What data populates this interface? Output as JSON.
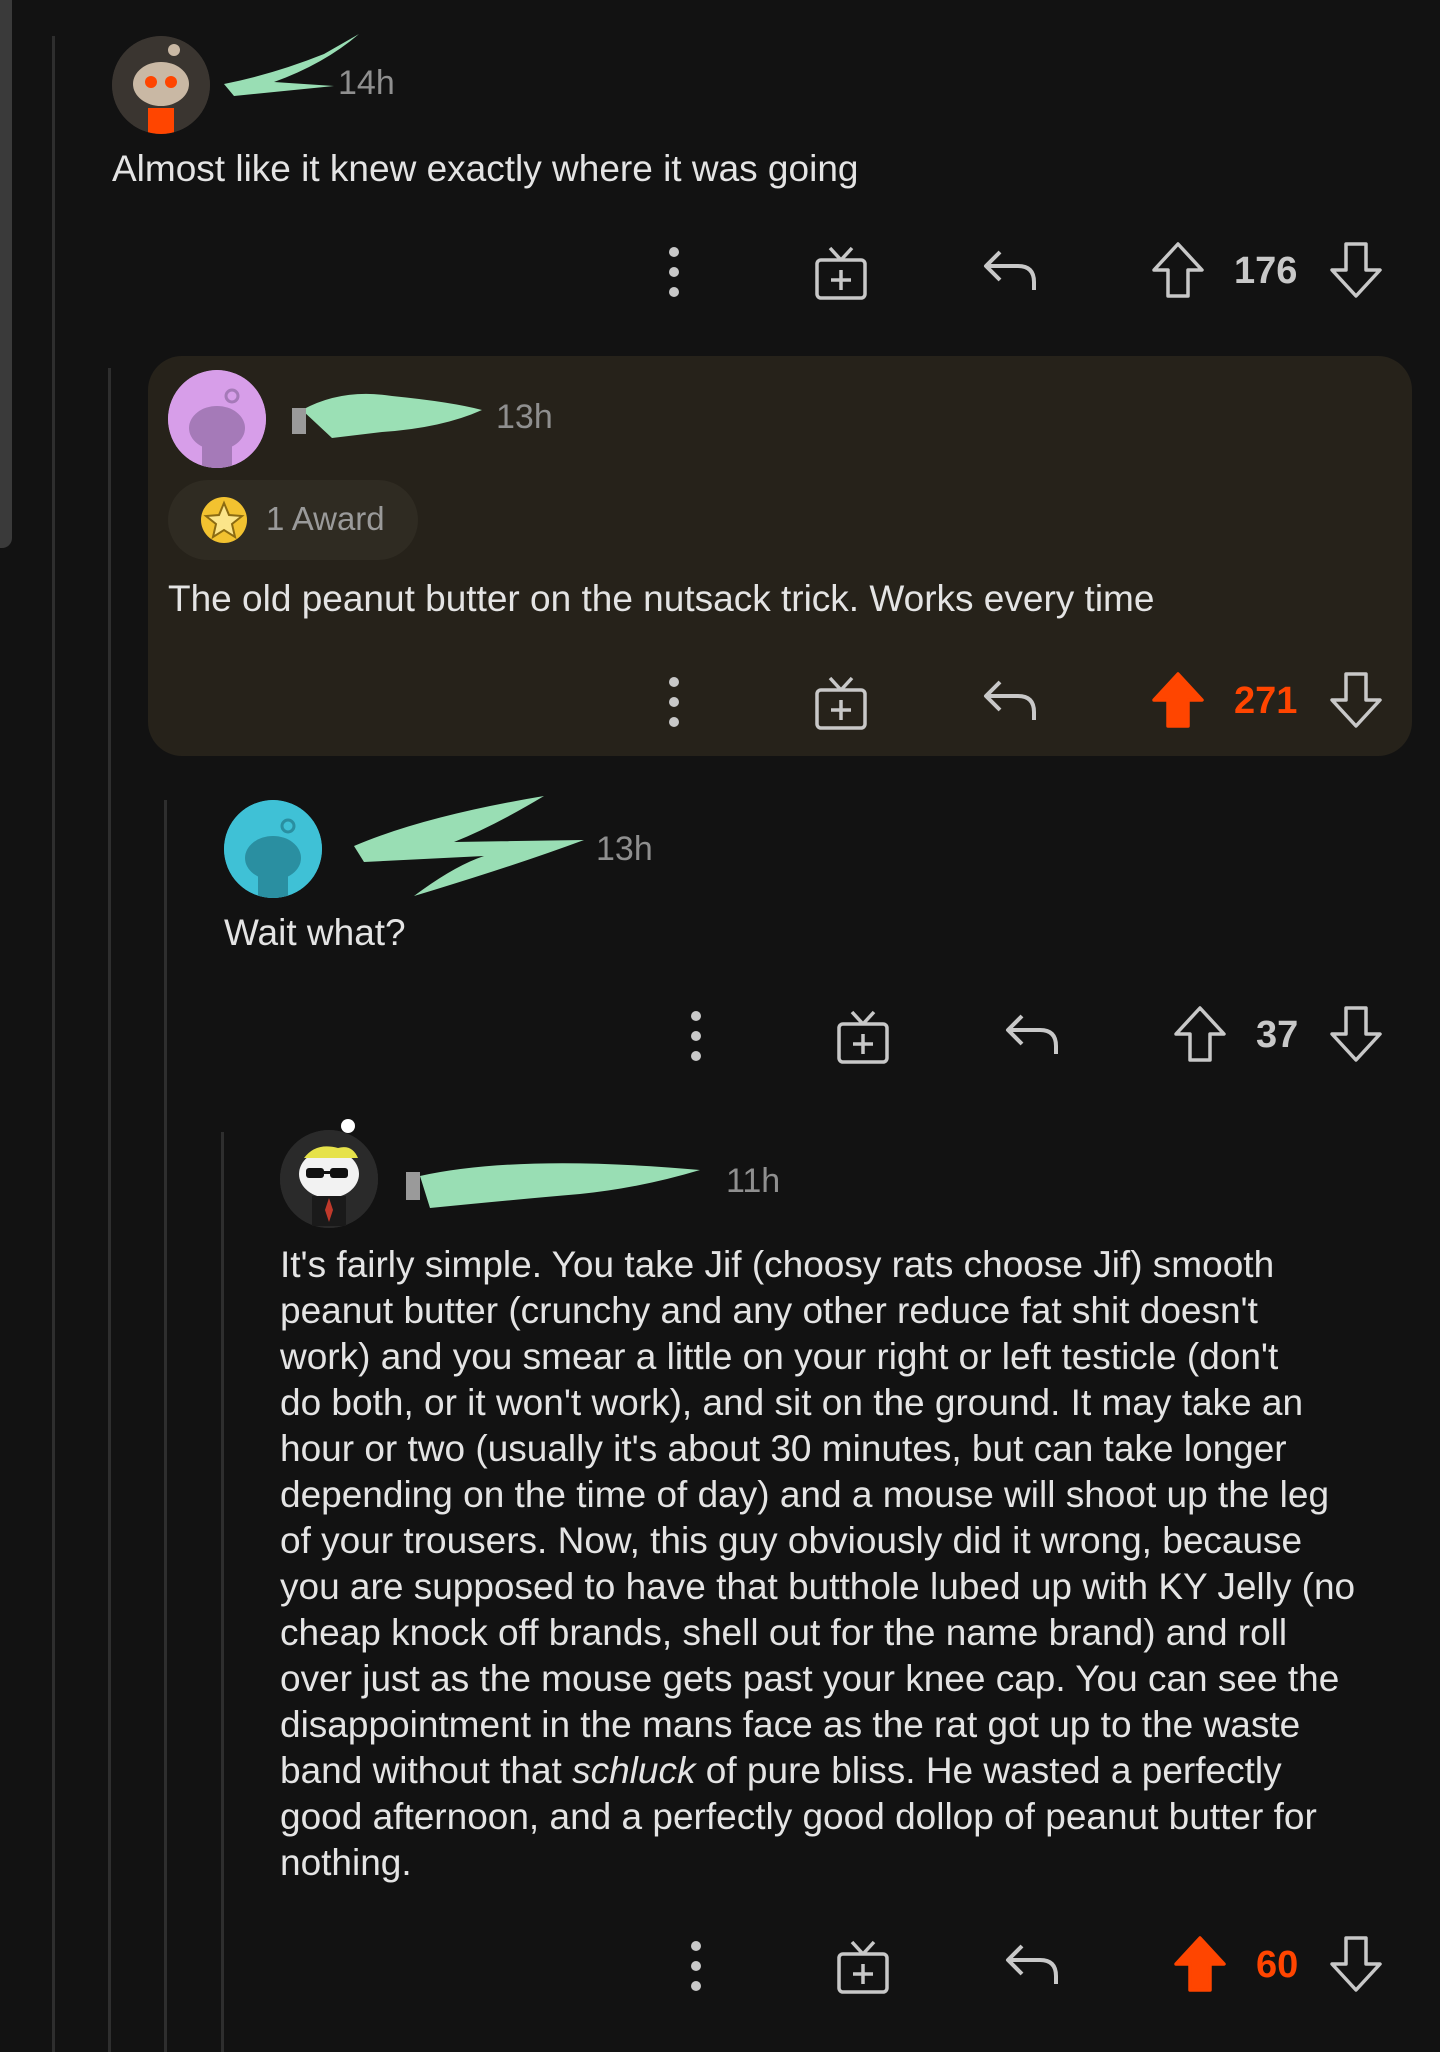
{
  "comments": [
    {
      "username": "",
      "time": "14h",
      "body": "Almost like it knew exactly where it was going",
      "score": "176",
      "upvoted": false
    },
    {
      "username": "",
      "time": "13h",
      "award_label": "1 Award",
      "body": "The old peanut butter on the nutsack trick. Works every time",
      "score": "271",
      "upvoted": true
    },
    {
      "username": "",
      "time": "13h",
      "body": "Wait what?",
      "score": "37",
      "upvoted": false
    },
    {
      "username": "",
      "time": "11h",
      "body_lines": [
        "It's fairly simple. You take Jif (choosy rats choose Jif) smooth",
        "peanut butter (crunchy and any other reduce fat shit doesn't",
        "work) and you smear a little on your right or left testicle (don't",
        "do both, or it won't work), and sit on the ground. It may take an",
        "hour or two (usually it's about 30 minutes, but can take longer",
        "depending on the time of day) and a mouse will shoot up the leg",
        "of your trousers. Now, this guy obviously did it wrong, because",
        "you are supposed to have that butthole lubed up with KY Jelly (no",
        "cheap knock off brands, shell out for the name brand) and roll",
        "over just as the mouse gets past your knee cap. You can see the",
        "disappointment in the mans face as the rat got up to the waste"
      ],
      "body_line_12_before": "band without that ",
      "body_line_12_italic": "schluck",
      "body_line_12_after": " of pure bliss. He wasted a perfectly",
      "body_lines_end": [
        "good afternoon, and a perfectly good dollop of peanut butter for",
        "nothing."
      ],
      "score": "60",
      "upvoted": true
    }
  ],
  "icons": {
    "more": "more-options-icon",
    "award": "give-award-icon",
    "reply": "reply-icon",
    "upvote": "upvote-icon",
    "downvote": "downvote-icon"
  },
  "colors": {
    "background": "#121212",
    "upvote_active": "#ff4500",
    "highlight": "#26221a",
    "scribble": "#a8f5c6"
  }
}
